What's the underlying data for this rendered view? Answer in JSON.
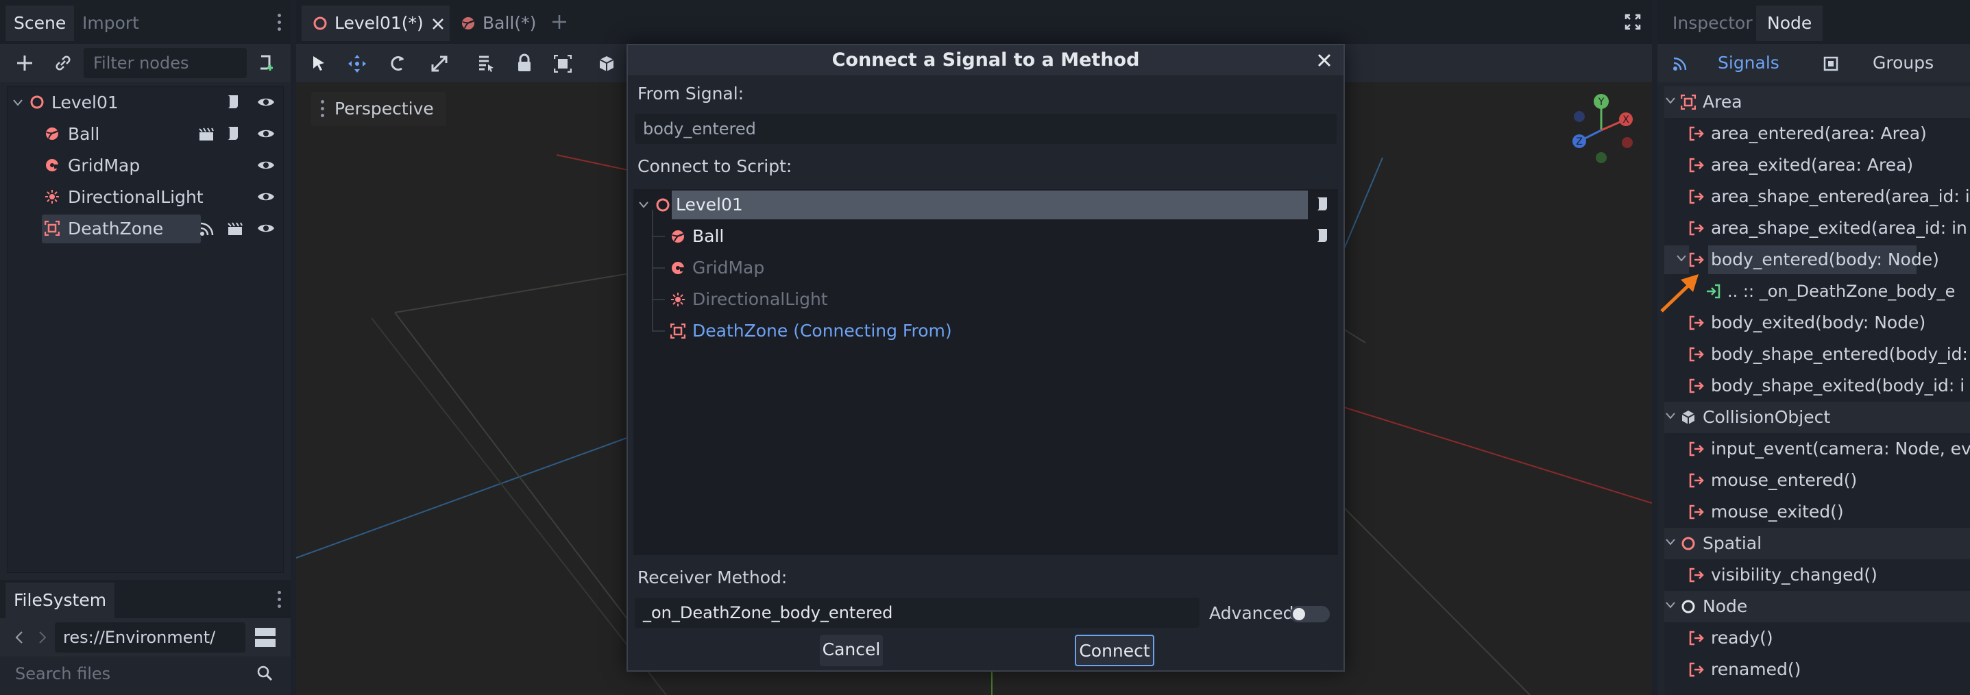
{
  "left_dock": {
    "tabs": [
      "Scene",
      "Import"
    ],
    "filter_placeholder": "Filter nodes",
    "tree": [
      {
        "label": "Level01"
      },
      {
        "label": "Ball"
      },
      {
        "label": "GridMap"
      },
      {
        "label": "DirectionalLight"
      },
      {
        "label": "DeathZone"
      }
    ],
    "filesystem": {
      "tab": "FileSystem",
      "path": "res://Environment/",
      "search_placeholder": "Search files"
    }
  },
  "center": {
    "tabs": [
      {
        "label": "Level01(*)"
      },
      {
        "label": "Ball(*)"
      }
    ],
    "perspective_label": "Perspective"
  },
  "right_dock": {
    "tabs": [
      "Inspector",
      "Node"
    ],
    "subtabs": [
      "Signals",
      "Groups"
    ],
    "signals": [
      {
        "label": "Area"
      },
      {
        "label": "area_entered(area: Area)"
      },
      {
        "label": "area_exited(area: Area)"
      },
      {
        "label": "area_shape_entered(area_id: i"
      },
      {
        "label": "area_shape_exited(area_id: in"
      },
      {
        "label": "body_entered(body: Node)"
      },
      {
        "label": ".. :: _on_DeathZone_body_e"
      },
      {
        "label": "body_exited(body: Node)"
      },
      {
        "label": "body_shape_entered(body_id:"
      },
      {
        "label": "body_shape_exited(body_id: i"
      },
      {
        "label": "CollisionObject"
      },
      {
        "label": "input_event(camera: Node, ev"
      },
      {
        "label": "mouse_entered()"
      },
      {
        "label": "mouse_exited()"
      },
      {
        "label": "Spatial"
      },
      {
        "label": "visibility_changed()"
      },
      {
        "label": "Node"
      },
      {
        "label": "ready()"
      },
      {
        "label": "renamed()"
      }
    ]
  },
  "dialog": {
    "title": "Connect a Signal to a Method",
    "from_signal_label": "From Signal:",
    "from_signal_value": "body_entered",
    "connect_script_label": "Connect to Script:",
    "script_tree": [
      {
        "label": "Level01"
      },
      {
        "label": "Ball"
      },
      {
        "label": "GridMap"
      },
      {
        "label": "DirectionalLight"
      },
      {
        "label": "DeathZone (Connecting From)"
      }
    ],
    "receiver_label": "Receiver Method:",
    "receiver_value": "_on_DeathZone_body_entered",
    "advanced_label": "Advanced",
    "advanced_on": false,
    "cancel_label": "Cancel",
    "connect_label": "Connect"
  },
  "colors": {
    "accent": "#6ea2f3",
    "node_3d": "#fc7f7f",
    "connection_green": "#5fd48a",
    "annotation_arrow": "#f07a1a"
  }
}
